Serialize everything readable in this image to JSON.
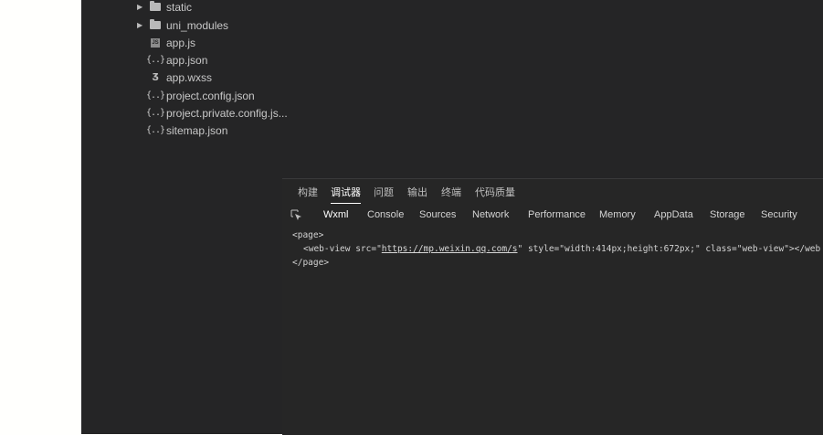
{
  "file_tree": [
    {
      "label": "static",
      "type": "folder",
      "icon": "folder-icon",
      "expandable": true
    },
    {
      "label": "uni_modules",
      "type": "folder",
      "icon": "folder-icon",
      "expandable": true
    },
    {
      "label": "app.js",
      "type": "file",
      "icon": "js-file-icon"
    },
    {
      "label": "app.json",
      "type": "file",
      "icon": "json-file-icon"
    },
    {
      "label": "app.wxss",
      "type": "file",
      "icon": "css-file-icon"
    },
    {
      "label": "project.config.json",
      "type": "file",
      "icon": "json-file-icon"
    },
    {
      "label": "project.private.config.js...",
      "type": "file",
      "icon": "json-file-icon"
    },
    {
      "label": "sitemap.json",
      "type": "file",
      "icon": "json-file-icon"
    }
  ],
  "panel_tabs": [
    {
      "label": "构建",
      "active": false
    },
    {
      "label": "调试器",
      "active": true
    },
    {
      "label": "问题",
      "active": false
    },
    {
      "label": "输出",
      "active": false
    },
    {
      "label": "终端",
      "active": false
    },
    {
      "label": "代码质量",
      "active": false
    }
  ],
  "sub_tabs": [
    {
      "label": "Wxml",
      "active": true
    },
    {
      "label": "Console",
      "active": false
    },
    {
      "label": "Sources",
      "active": false
    },
    {
      "label": "Network",
      "active": false
    },
    {
      "label": "Performance",
      "active": false
    },
    {
      "label": "Memory",
      "active": false
    },
    {
      "label": "AppData",
      "active": false
    },
    {
      "label": "Storage",
      "active": false
    },
    {
      "label": "Security",
      "active": false
    }
  ],
  "dom": {
    "open_page": "<page>",
    "webview_prefix": "<web-view src=\"",
    "webview_url": "https://mp.weixin.qq.com/s",
    "webview_suffix": "\" style=\"width:414px;height:672px;\" class=\"web-view\"></web",
    "close_page": "</page>"
  }
}
